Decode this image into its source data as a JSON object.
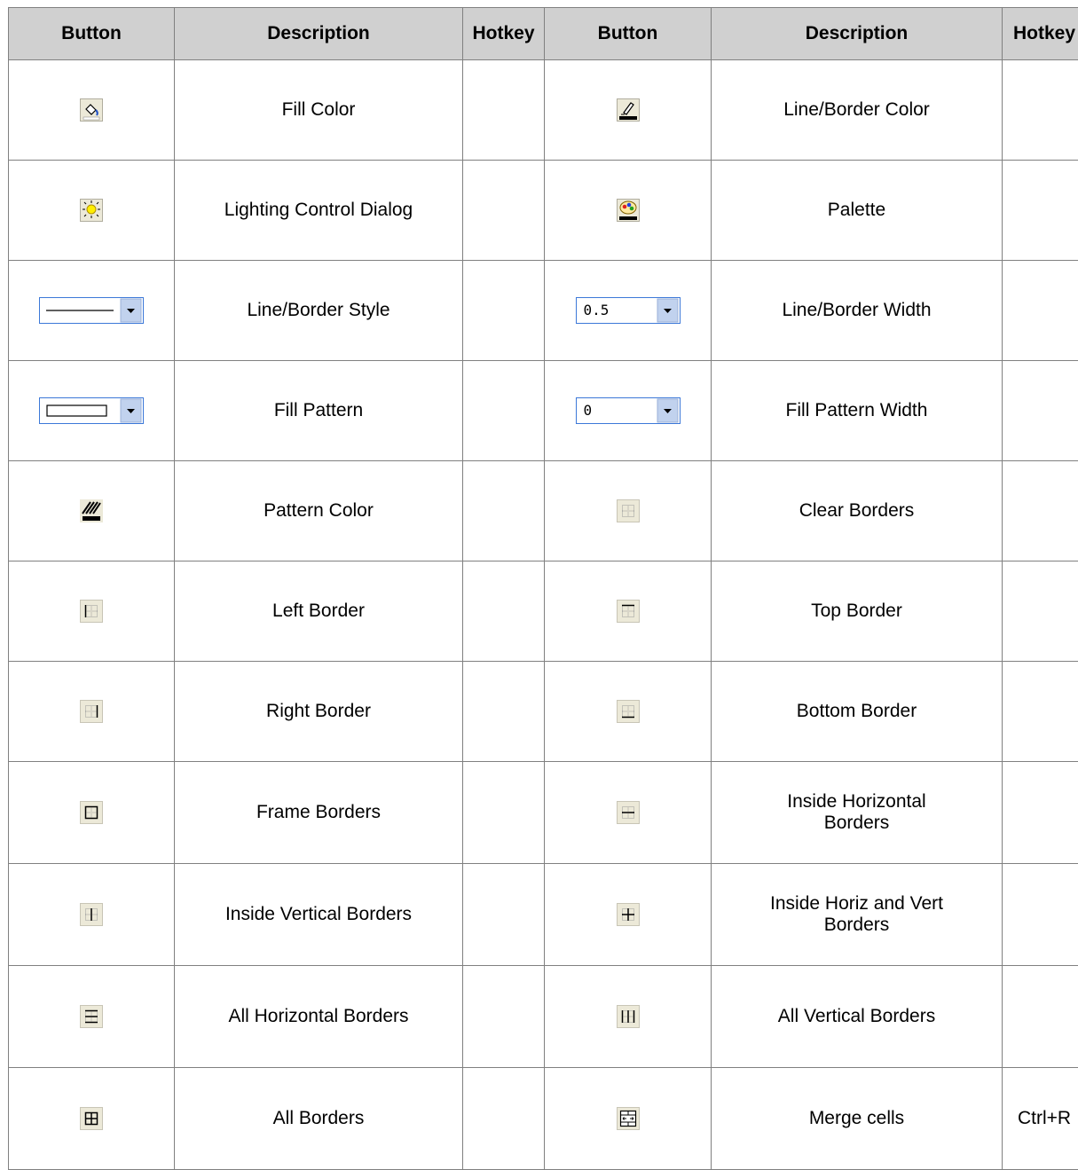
{
  "headers": {
    "button1": "Button",
    "description1": "Description",
    "hotkey1": "Hotkey",
    "button2": "Button",
    "description2": "Description",
    "hotkey2": "Hotkey"
  },
  "rows": [
    {
      "left": {
        "icon": "fill-color-icon",
        "description": "Fill Color",
        "hotkey": ""
      },
      "right": {
        "icon": "line-border-color-icon",
        "description": "Line/Border Color",
        "hotkey": ""
      }
    },
    {
      "left": {
        "icon": "lighting-control-icon",
        "description": "Lighting Control Dialog",
        "hotkey": ""
      },
      "right": {
        "icon": "palette-icon",
        "description": "Palette",
        "hotkey": ""
      }
    },
    {
      "left": {
        "icon": "line-style-dropdown",
        "description": "Line/Border Style",
        "hotkey": ""
      },
      "right": {
        "icon": "line-width-dropdown",
        "value": "0.5",
        "description": "Line/Border Width",
        "hotkey": ""
      }
    },
    {
      "left": {
        "icon": "fill-pattern-dropdown",
        "description": "Fill Pattern",
        "hotkey": ""
      },
      "right": {
        "icon": "fill-pattern-width-dropdown",
        "value": "0",
        "description": "Fill Pattern Width",
        "hotkey": ""
      }
    },
    {
      "left": {
        "icon": "pattern-color-icon",
        "description": "Pattern Color",
        "hotkey": ""
      },
      "right": {
        "icon": "clear-borders-icon",
        "description": "Clear Borders",
        "hotkey": ""
      }
    },
    {
      "left": {
        "icon": "left-border-icon",
        "description": "Left Border",
        "hotkey": ""
      },
      "right": {
        "icon": "top-border-icon",
        "description": "Top Border",
        "hotkey": ""
      }
    },
    {
      "left": {
        "icon": "right-border-icon",
        "description": "Right Border",
        "hotkey": ""
      },
      "right": {
        "icon": "bottom-border-icon",
        "description": "Bottom Border",
        "hotkey": ""
      }
    },
    {
      "left": {
        "icon": "frame-borders-icon",
        "description": "Frame Borders",
        "hotkey": ""
      },
      "right": {
        "icon": "inside-horizontal-borders-icon",
        "description_lines": [
          "Inside Horizontal",
          "Borders"
        ],
        "hotkey": ""
      }
    },
    {
      "left": {
        "icon": "inside-vertical-borders-icon",
        "description": "Inside Vertical Borders",
        "hotkey": ""
      },
      "right": {
        "icon": "inside-horiz-vert-borders-icon",
        "description_lines": [
          "Inside Horiz and Vert",
          "Borders"
        ],
        "hotkey": ""
      }
    },
    {
      "left": {
        "icon": "all-horizontal-borders-icon",
        "description": "All Horizontal Borders",
        "hotkey": ""
      },
      "right": {
        "icon": "all-vertical-borders-icon",
        "description": "All Vertical Borders",
        "hotkey": ""
      }
    },
    {
      "left": {
        "icon": "all-borders-icon",
        "description": "All Borders",
        "hotkey": ""
      },
      "right": {
        "icon": "merge-cells-icon",
        "description": "Merge cells",
        "hotkey": "Ctrl+R"
      }
    }
  ]
}
